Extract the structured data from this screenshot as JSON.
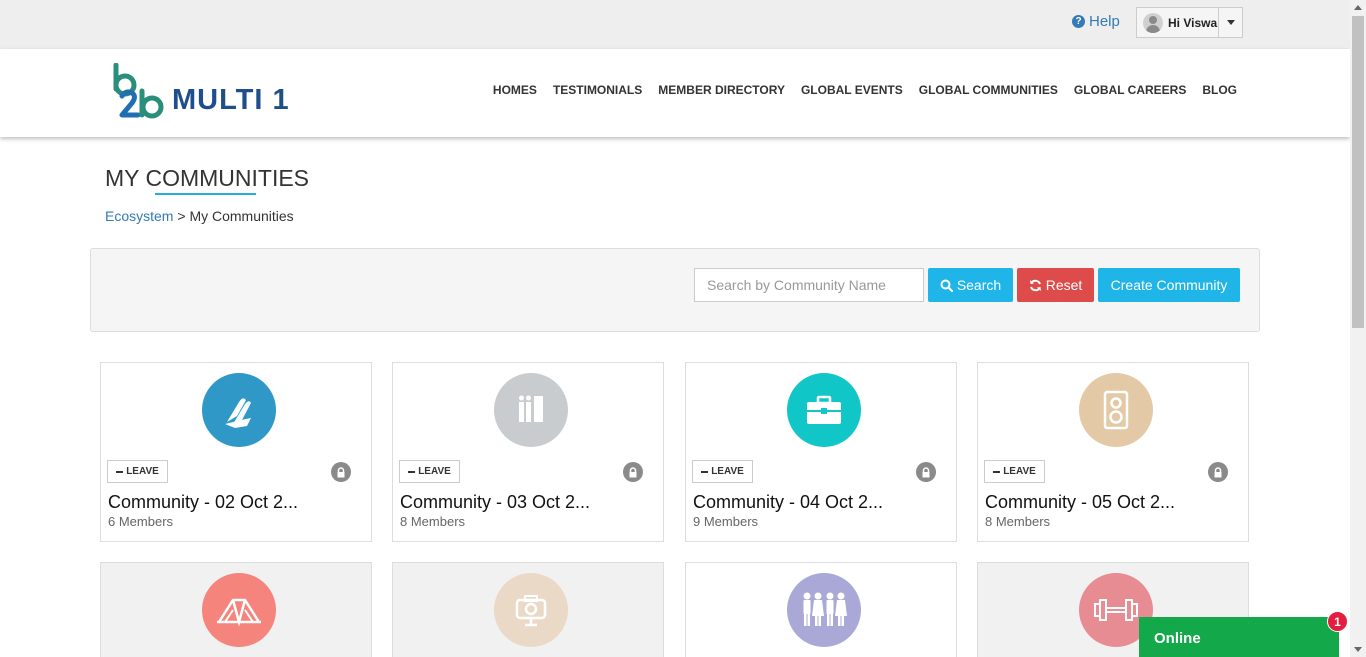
{
  "topbar": {
    "help_label": "Help",
    "user_greeting": "Hi Viswa"
  },
  "header": {
    "logo_mark": "b2b",
    "logo_text": "MULTI 1",
    "nav": [
      {
        "label": "HOMES"
      },
      {
        "label": "TESTIMONIALS"
      },
      {
        "label": "MEMBER DIRECTORY"
      },
      {
        "label": "GLOBAL EVENTS"
      },
      {
        "label": "GLOBAL COMMUNITIES"
      },
      {
        "label": "GLOBAL CAREERS"
      },
      {
        "label": "BLOG"
      }
    ]
  },
  "page": {
    "title": "MY COMMUNITIES",
    "breadcrumb_link": "Ecosystem",
    "breadcrumb_separator": " > ",
    "breadcrumb_current": "My Communities"
  },
  "filter": {
    "search_placeholder": "Search by Community Name",
    "search_value": "",
    "search_button": "Search",
    "reset_button": "Reset",
    "create_button": "Create Community"
  },
  "communities": [
    {
      "title": "Community - 02 Oct 2...",
      "members": "6 Members",
      "leave_label": "LEAVE",
      "icon": "praying-hands-icon",
      "icon_color": "#2f98c7"
    },
    {
      "title": "Community - 03 Oct 2...",
      "members": "8 Members",
      "leave_label": "LEAVE",
      "icon": "library-books-icon",
      "icon_color": "#c9ccce"
    },
    {
      "title": "Community - 04 Oct 2...",
      "members": "9 Members",
      "leave_label": "LEAVE",
      "icon": "briefcase-icon",
      "icon_color": "#11c6c6"
    },
    {
      "title": "Community - 05 Oct 2...",
      "members": "8 Members",
      "leave_label": "LEAVE",
      "icon": "speaker-icon",
      "icon_color": "#e3c9a6"
    },
    {
      "icon": "tent-icon",
      "icon_color": "#f4847c"
    },
    {
      "icon": "projector-camera-icon",
      "icon_color": "#ead9c6"
    },
    {
      "icon": "group-people-icon",
      "icon_color": "#aaa8d6"
    },
    {
      "icon": "dumbbell-icon",
      "icon_color": "#e68c92"
    }
  ],
  "chat": {
    "status_label": "Online",
    "badge_count": "1"
  },
  "colors": {
    "primary_button": "#1fb5e8",
    "danger_button": "#dd4b4b",
    "chat_green": "#13a84a",
    "link_blue": "#337ab7"
  }
}
